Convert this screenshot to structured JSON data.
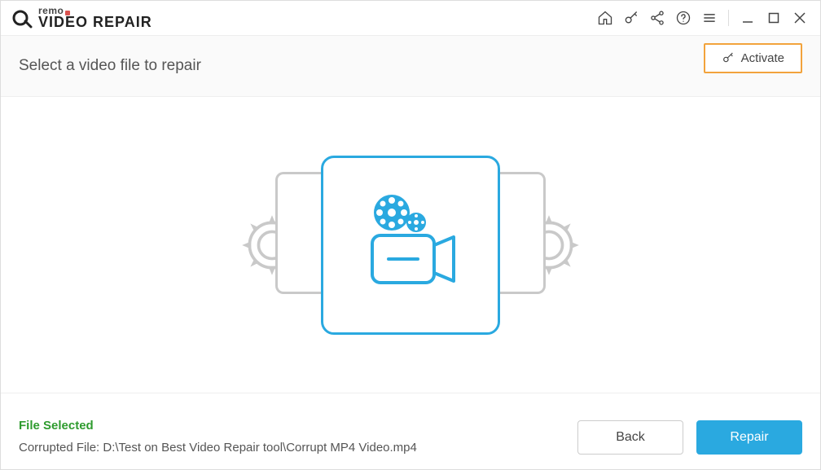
{
  "app": {
    "brand_top": "remo",
    "brand_main": "VIDEO REPAIR"
  },
  "header": {
    "title": "Select a video file to repair",
    "activate_label": "Activate"
  },
  "footer": {
    "status_label": "File Selected",
    "file_label_prefix": "Corrupted File: ",
    "file_path": "D:\\Test on Best Video Repair tool\\Corrupt MP4 Video.mp4",
    "back_label": "Back",
    "repair_label": "Repair"
  },
  "icons": {
    "home": "home",
    "key": "key",
    "share": "share",
    "help": "help",
    "menu": "menu",
    "minimize": "minimize",
    "maximize": "maximize",
    "close": "close"
  },
  "colors": {
    "accent": "#2aa9e0",
    "activate_border": "#f2a33c",
    "success": "#2e9b2e"
  }
}
